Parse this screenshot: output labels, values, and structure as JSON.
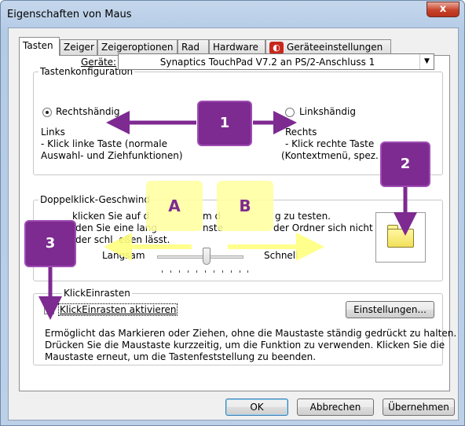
{
  "window": {
    "title": "Eigenschaften von Maus",
    "close_label": "x"
  },
  "tabs": [
    {
      "label": "Tasten"
    },
    {
      "label": "Zeiger"
    },
    {
      "label": "Zeigeroptionen"
    },
    {
      "label": "Rad"
    },
    {
      "label": "Hardware"
    },
    {
      "label": "Geräteeinstellungen"
    }
  ],
  "button_config": {
    "group_label": "Tastenkonfiguration",
    "device_label": "Geräte:",
    "device_value": "Synaptics TouchPad V7.2 an PS/2-Anschluss 1",
    "right_handed": "Rechtshändig",
    "left_handed": "Linkshändig",
    "left_title": "Links",
    "left_desc_1": " - Klick linke Taste (normale",
    "left_desc_2": "Auswahl- und Ziehfunktionen)",
    "right_title": "Rechts",
    "right_desc_1": " - Klick rechte Taste",
    "right_desc_2": "(Kontextmenü, spez."
  },
  "doubleclick": {
    "group_label": "Doppelklick-Geschwind",
    "line1": "klicken Sie auf d",
    "line1b": "m d",
    "line1c": "g zu testen.",
    "line2": "den Sie eine lang",
    "line2b": "nste",
    "line2c": "der Ordner sich nicht",
    "line3": "der schl",
    "line3b": "eßen lässt.",
    "slow": "Langsam",
    "fast": "Schnell"
  },
  "clicklock": {
    "group_label": "KlickEinrasten",
    "checkbox_label": "KlickEinrasten aktivieren",
    "checked": true,
    "settings_button": "Einstellungen...",
    "description_1": "Ermöglicht das Markieren oder Ziehen, ohne die Maustaste ständig gedrückt zu halten.",
    "description_2": "Drücken Sie die Maustaste kurzzeitig, um die Funktion zu verwenden. Klicken Sie die",
    "description_3": "Maustaste erneut, um die Tastenfeststellung zu beenden."
  },
  "footer": {
    "ok": "OK",
    "cancel": "Abbrechen",
    "apply": "Übernehmen"
  },
  "annotations": {
    "n1": "1",
    "n2": "2",
    "n3": "3",
    "a": "A",
    "b": "B"
  },
  "colors": {
    "annotation_purple": "#7d2a91",
    "annotation_yellow": "#ffffa0"
  }
}
